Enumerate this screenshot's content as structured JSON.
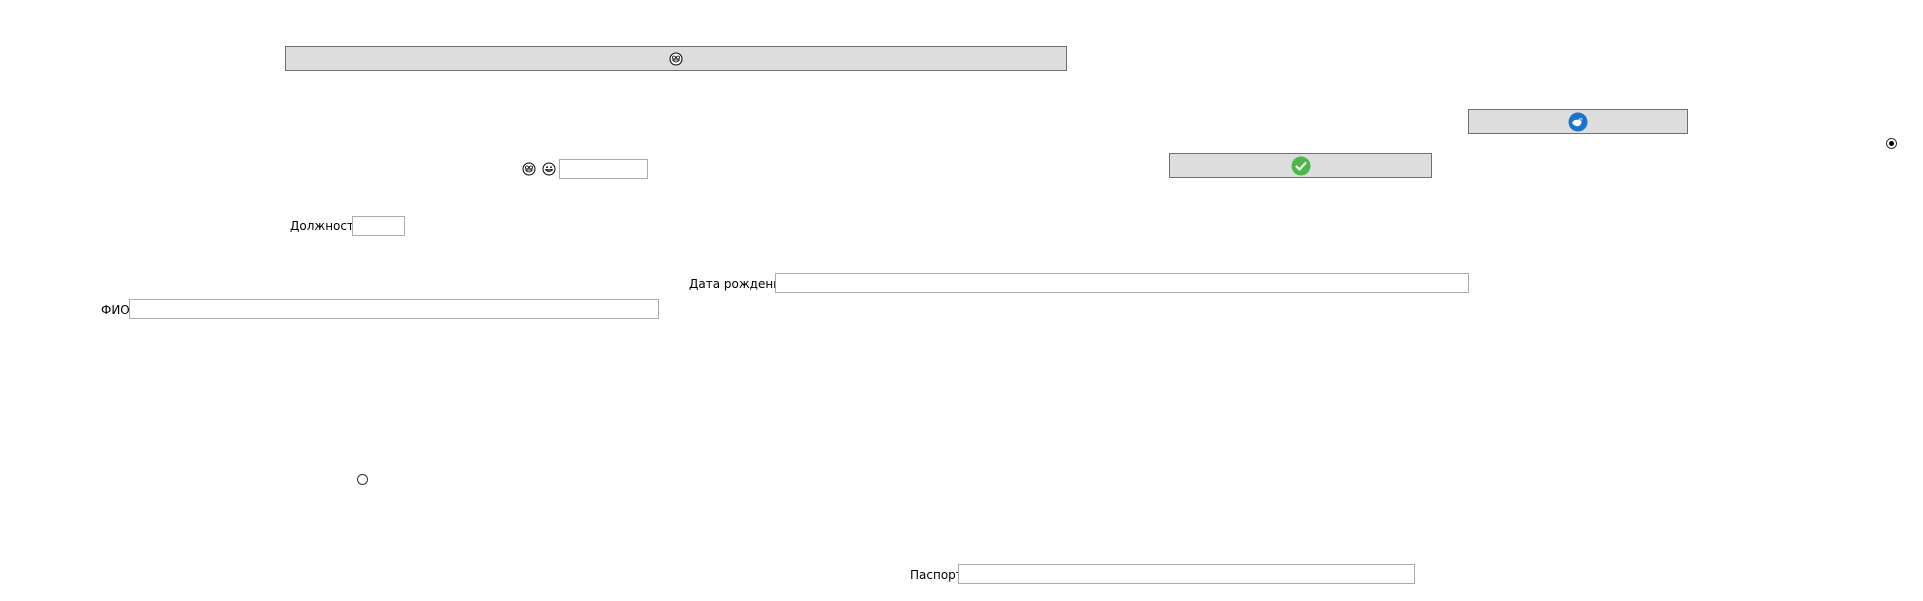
{
  "colors": {
    "button_bg": "#dddddd",
    "button_border": "#707070",
    "field_border": "#ababab",
    "check_green": "#4cb84c",
    "bird_blue": "#1a73c9"
  },
  "buttons": {
    "top_wide": {
      "icon": "smiley-face-icon"
    },
    "right_top": {
      "icon": "blue-bird-icon"
    },
    "middle": {
      "icon": "green-checkmark-icon"
    }
  },
  "emoji_row": {
    "icons": [
      "smiley-face-icon",
      "grinning-face-icon"
    ],
    "input_value": ""
  },
  "form": {
    "position_label": "Должность",
    "position_value": "",
    "birthdate_label": "Дата рождения",
    "birthdate_value": "",
    "fio_label": "ФИО",
    "fio_value": "",
    "passport_label": "Паспорт",
    "passport_value": ""
  },
  "radios": {
    "right_radio_checked": true,
    "left_radio_checked": false
  }
}
